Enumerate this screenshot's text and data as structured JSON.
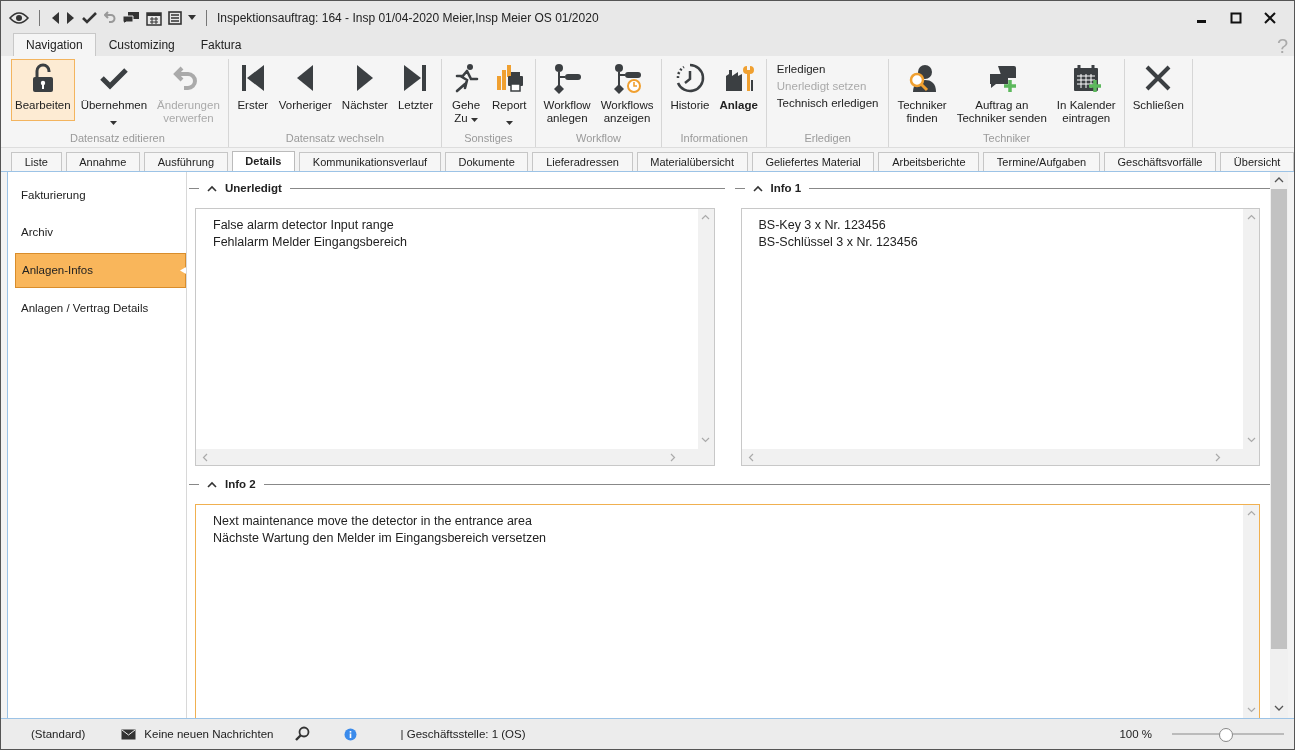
{
  "window": {
    "title": "Inspektionsauftrag: 164 - Insp 01/04-2020 Meier,Insp Meier OS 01/2020"
  },
  "ribbon_tabs": [
    {
      "label": "Navigation",
      "selected": true
    },
    {
      "label": "Customizing",
      "selected": false
    },
    {
      "label": "Faktura",
      "selected": false
    }
  ],
  "help": "?",
  "ribbon_groups": [
    {
      "label": "Datensatz editieren",
      "items": [
        {
          "kind": "large",
          "lines": [
            "Bearbeiten"
          ],
          "pressed": true,
          "disabled": false,
          "active": false
        },
        {
          "kind": "large",
          "lines": [
            "Übernehmen"
          ],
          "pressed": false,
          "disabled": false,
          "dropdown": true,
          "active": false
        },
        {
          "kind": "large",
          "lines": [
            "Änderungen",
            "verwerfen"
          ],
          "pressed": false,
          "disabled": true,
          "active": false
        }
      ]
    },
    {
      "label": "Datensatz wechseln",
      "items": [
        {
          "kind": "large",
          "lines": [
            "Erster"
          ],
          "pressed": false,
          "disabled": false,
          "active": false
        },
        {
          "kind": "large",
          "lines": [
            "Vorheriger"
          ],
          "pressed": false,
          "disabled": false,
          "active": false
        },
        {
          "kind": "large",
          "lines": [
            "Nächster"
          ],
          "pressed": false,
          "disabled": false,
          "active": false
        },
        {
          "kind": "large",
          "lines": [
            "Letzter"
          ],
          "pressed": false,
          "disabled": false,
          "active": false
        }
      ]
    },
    {
      "label": "Sonstiges",
      "items": [
        {
          "kind": "large",
          "lines": [
            "Gehe",
            "Zu"
          ],
          "pressed": false,
          "disabled": false,
          "dropdown": true,
          "active": false
        },
        {
          "kind": "large",
          "lines": [
            "Report"
          ],
          "pressed": false,
          "disabled": false,
          "dropdown": true,
          "active": false
        }
      ]
    },
    {
      "label": "Workflow",
      "items": [
        {
          "kind": "large",
          "lines": [
            "Workflow",
            "anlegen"
          ],
          "pressed": false,
          "disabled": false,
          "active": false
        },
        {
          "kind": "large",
          "lines": [
            "Workflows",
            "anzeigen"
          ],
          "pressed": false,
          "disabled": false,
          "active": false
        }
      ]
    },
    {
      "label": "Informationen",
      "items": [
        {
          "kind": "large",
          "lines": [
            "Historie"
          ],
          "pressed": false,
          "disabled": false,
          "active": false
        },
        {
          "kind": "large",
          "lines": [
            "Anlage"
          ],
          "pressed": false,
          "disabled": false,
          "active": true
        }
      ]
    },
    {
      "label": "Erledigen",
      "items": [
        {
          "kind": "small",
          "lines": [
            "Erledigen"
          ],
          "pressed": false,
          "disabled": false,
          "active": false
        },
        {
          "kind": "small",
          "lines": [
            "Unerledigt setzen"
          ],
          "pressed": false,
          "disabled": true,
          "active": false
        },
        {
          "kind": "small",
          "lines": [
            "Technisch erledigen"
          ],
          "pressed": false,
          "disabled": false,
          "active": false
        }
      ]
    },
    {
      "label": "Techniker",
      "items": [
        {
          "kind": "large",
          "lines": [
            "Techniker",
            "finden"
          ],
          "pressed": false,
          "disabled": false,
          "active": false
        },
        {
          "kind": "large",
          "lines": [
            "Auftrag an",
            "Techniker senden"
          ],
          "pressed": false,
          "disabled": false,
          "active": false
        },
        {
          "kind": "large",
          "lines": [
            "In Kalender",
            "eintragen"
          ],
          "pressed": false,
          "disabled": false,
          "active": false
        }
      ]
    },
    {
      "items": [
        {
          "kind": "large",
          "lines": [
            "Schließen"
          ],
          "pressed": false,
          "disabled": false,
          "active": false
        }
      ]
    }
  ],
  "detail_tabs": [
    {
      "label": "Liste",
      "selected": false
    },
    {
      "label": "Annahme",
      "selected": false
    },
    {
      "label": "Ausführung",
      "selected": false
    },
    {
      "label": "Details",
      "selected": true
    },
    {
      "label": "Kommunikationsverlauf",
      "selected": false
    },
    {
      "label": "Dokumente",
      "selected": false
    },
    {
      "label": "Lieferadressen",
      "selected": false
    },
    {
      "label": "Materialübersicht",
      "selected": false
    },
    {
      "label": "Geliefertes Material",
      "selected": false
    },
    {
      "label": "Arbeitsberichte",
      "selected": false
    },
    {
      "label": "Termine/Aufgaben",
      "selected": false
    },
    {
      "label": "Geschäftsvorfälle",
      "selected": false
    },
    {
      "label": "Übersicht",
      "selected": false
    }
  ],
  "sidebar": {
    "items": [
      {
        "label": "Fakturierung",
        "selected": false
      },
      {
        "label": "Archiv",
        "selected": false
      },
      {
        "label": "Anlagen-Infos",
        "selected": true
      },
      {
        "label": "Anlagen / Vertrag Details",
        "selected": false
      }
    ]
  },
  "sections": [
    {
      "title": "Unerledigt",
      "expanded": true,
      "focused": false,
      "lines": [
        "False alarm detector Input range",
        "Fehlalarm Melder Eingangsbereich"
      ]
    },
    {
      "title": "Info 1",
      "expanded": true,
      "focused": false,
      "lines": [
        "BS-Key 3 x Nr. 123456",
        "BS-Schlüssel 3 x Nr. 123456"
      ]
    },
    {
      "title": "Info 2",
      "expanded": true,
      "focused": true,
      "lines": [
        "Next maintenance move the detector in the entrance area",
        "Nächste Wartung den Melder im Eingangsbereich versetzen"
      ]
    }
  ],
  "status_bar": {
    "layout": "(Standard)",
    "messages": "Keine neuen Nachrichten",
    "office": "| Geschäftsstelle:  1 (OS)",
    "zoom": "100 %",
    "zoom_slider": {
      "level": 0.48
    }
  }
}
